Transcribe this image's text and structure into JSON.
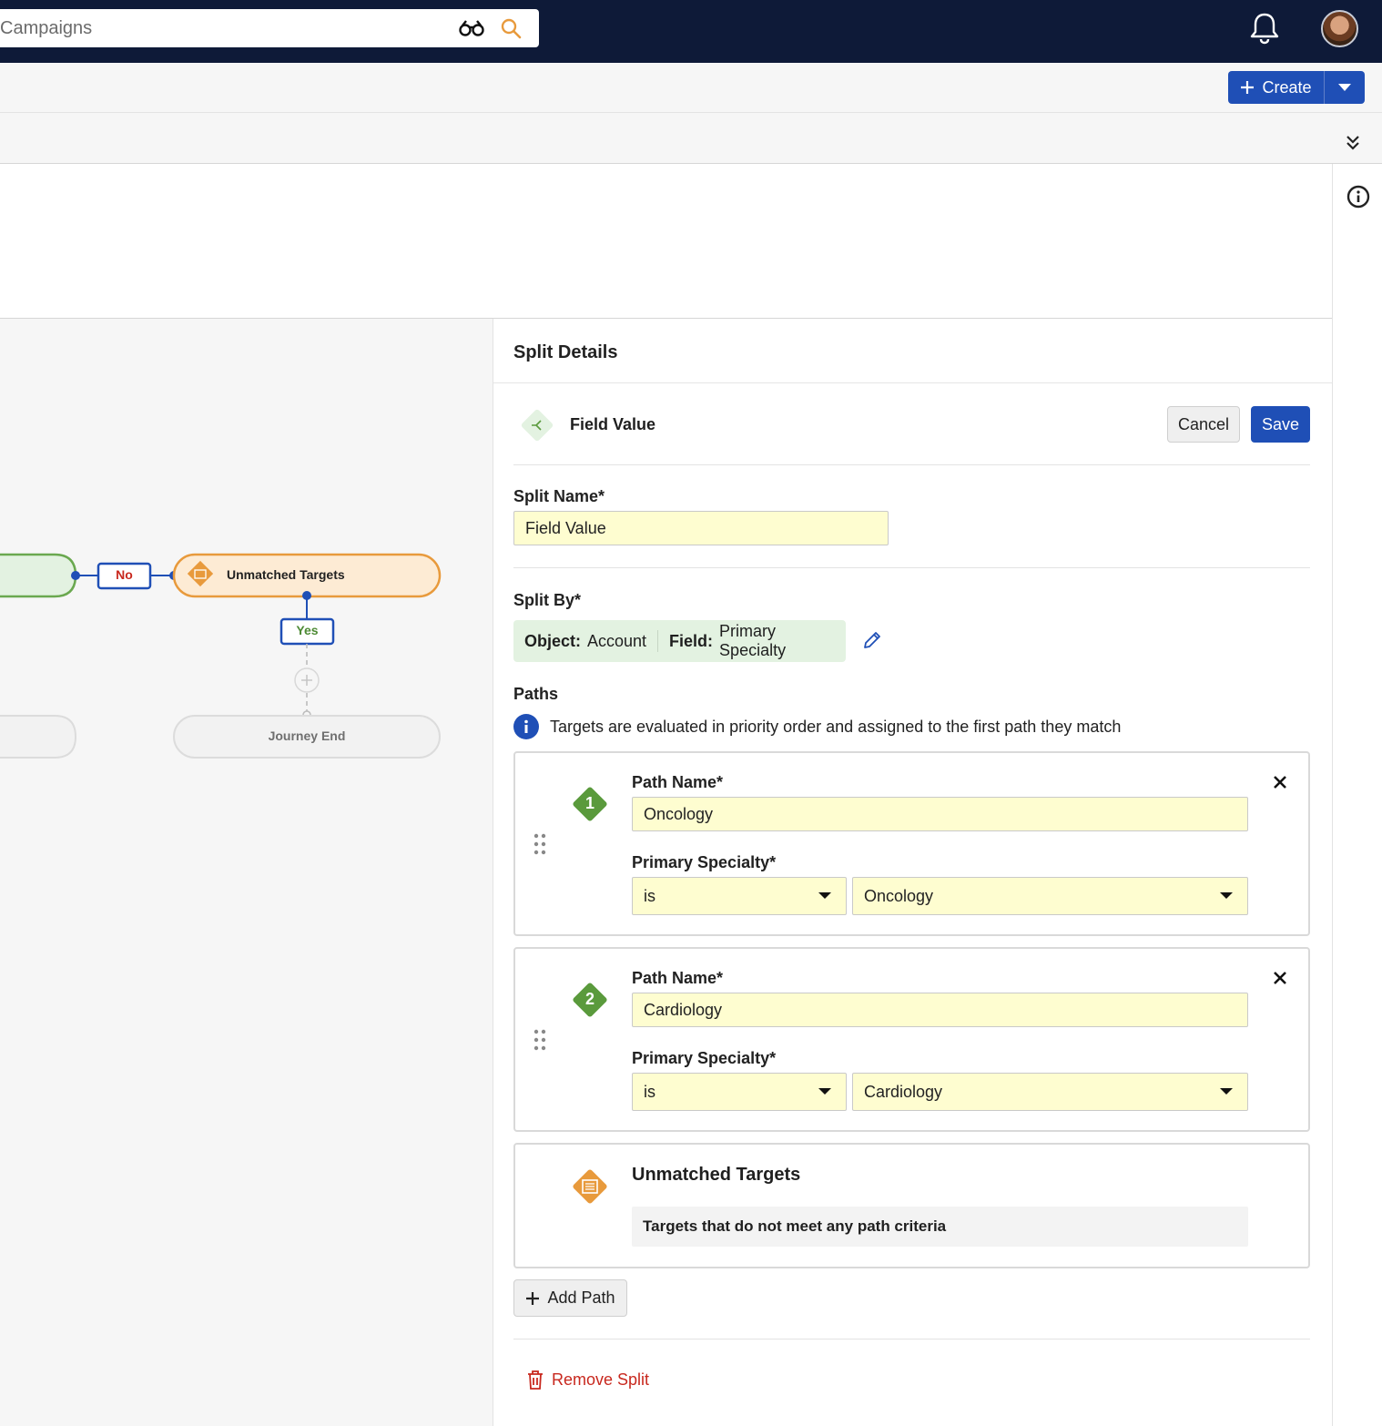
{
  "topbar": {
    "search_text": "Campaigns",
    "icons": {
      "binoculars": "binoculars-icon",
      "search": "search-icon",
      "notifications": "bell-icon"
    }
  },
  "toolbar": {
    "create_label": "Create"
  },
  "canvas": {
    "nodes": {
      "no_label": "No",
      "unmatched_label": "Unmatched Targets",
      "yes_label": "Yes",
      "journey_end_label": "Journey End"
    }
  },
  "panel": {
    "title": "Split Details",
    "split_type": "Field Value",
    "cancel_label": "Cancel",
    "save_label": "Save",
    "split_name_label": "Split Name*",
    "split_name_value": "Field Value",
    "split_by_label": "Split By*",
    "split_by": {
      "object_key": "Object:",
      "object_value": "Account",
      "field_key": "Field:",
      "field_value": "Primary Specialty"
    },
    "paths_label": "Paths",
    "paths_note": "Targets are evaluated in priority order and assigned to the first path they match",
    "paths": [
      {
        "number": "1",
        "name_label": "Path Name*",
        "name_value": "Oncology",
        "criteria_label": "Primary Specialty*",
        "operator": "is",
        "value": "Oncology"
      },
      {
        "number": "2",
        "name_label": "Path Name*",
        "name_value": "Cardiology",
        "criteria_label": "Primary Specialty*",
        "operator": "is",
        "value": "Cardiology"
      }
    ],
    "unmatched": {
      "title": "Unmatched Targets",
      "description": "Targets that do not meet any path criteria"
    },
    "add_path_label": "Add Path",
    "remove_split_label": "Remove Split"
  },
  "colors": {
    "navbar": "#0e1a38",
    "primary": "#1f4fb6",
    "path_green": "#5a9a3c",
    "unmatched_orange": "#e89a3c",
    "input_yellow": "#fefdd0",
    "danger": "#c8281e"
  }
}
